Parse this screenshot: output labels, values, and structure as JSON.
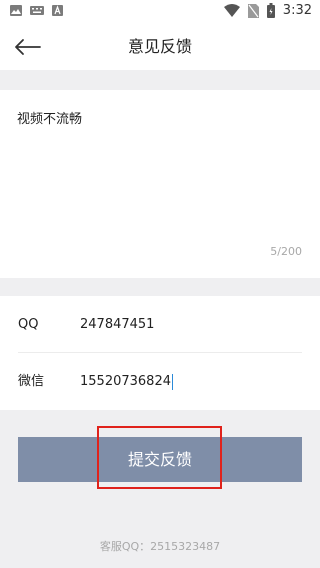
{
  "status_bar": {
    "time": "3:32",
    "left_icons": [
      "image-icon",
      "keyboard-icon",
      "text-icon"
    ],
    "right_icons": [
      "wifi-icon",
      "no-sim-icon",
      "battery-icon"
    ]
  },
  "header": {
    "title": "意见反馈",
    "back_icon": "arrow-left-icon"
  },
  "feedback": {
    "text": "视频不流畅",
    "counter": "5/200"
  },
  "contact": {
    "qq_label": "QQ",
    "qq_value": "247847451",
    "wechat_label": "微信",
    "wechat_value": "15520736824"
  },
  "submit": {
    "label": "提交反馈"
  },
  "footer": {
    "service_text": "客服QQ：2515323487"
  },
  "colors": {
    "button": "#7f8ea8",
    "highlight": "#e0221b",
    "background": "#efeff1"
  }
}
